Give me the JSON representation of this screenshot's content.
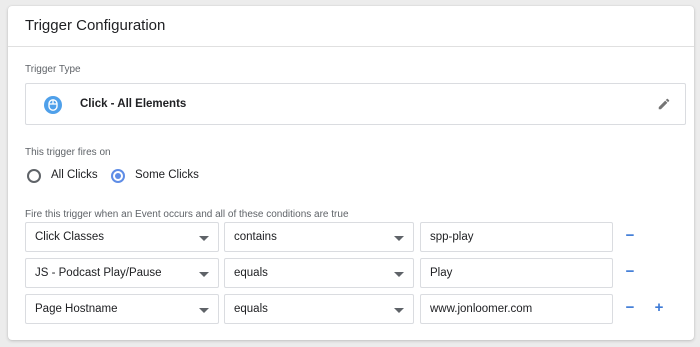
{
  "card": {
    "title": "Trigger Configuration"
  },
  "trigger_type": {
    "label": "Trigger Type",
    "name": "Click - All Elements",
    "icon": "mouse-icon",
    "icon_color": "#4fa0ea",
    "edit_icon": "pencil-icon"
  },
  "fires_on": {
    "label": "This trigger fires on",
    "options": [
      {
        "label": "All Clicks",
        "selected": false
      },
      {
        "label": "Some Clicks",
        "selected": true
      }
    ]
  },
  "conditions": {
    "label": "Fire this trigger when an Event occurs and all of these conditions are true",
    "rows": [
      {
        "variable": "Click Classes",
        "operator": "contains",
        "value": "spp-play",
        "remove": "−"
      },
      {
        "variable": "JS - Podcast Play/Pause",
        "operator": "equals",
        "value": "Play",
        "remove": "−"
      },
      {
        "variable": "Page Hostname",
        "operator": "equals",
        "value": "www.jonloomer.com",
        "remove": "−",
        "add": "+"
      }
    ]
  },
  "colors": {
    "accent": "#5f8de6",
    "action": "#3d7ad6"
  }
}
